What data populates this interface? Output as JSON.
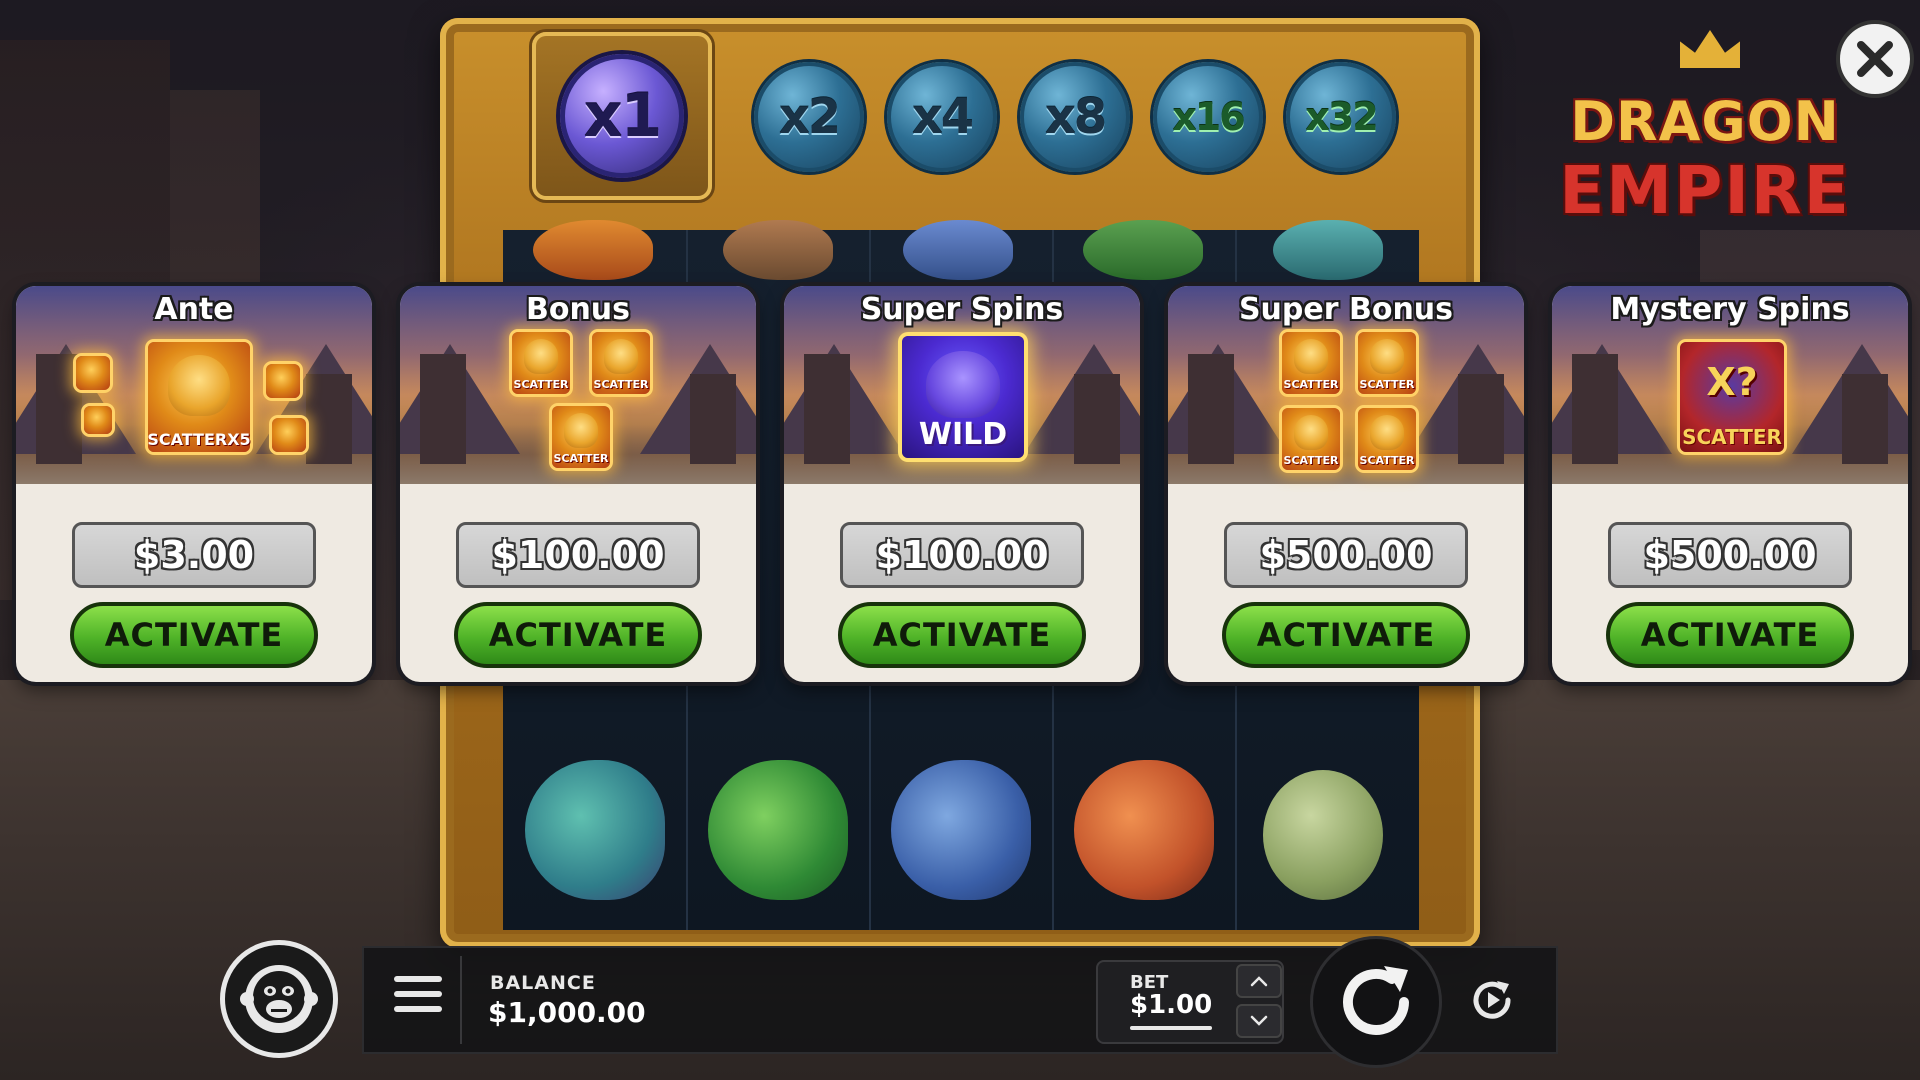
{
  "multipliers": [
    "x1",
    "x2",
    "x4",
    "x8",
    "x16",
    "x32"
  ],
  "active_multiplier": "x1",
  "logo": {
    "line1": "DRAGON",
    "line2": "EMPIRE"
  },
  "cards": [
    {
      "title": "Ante",
      "price": "$3.00",
      "button": "ACTIVATE",
      "symbol_label": "SCATTERX5"
    },
    {
      "title": "Bonus",
      "price": "$100.00",
      "button": "ACTIVATE",
      "symbol_label": "SCATTER"
    },
    {
      "title": "Super Spins",
      "price": "$100.00",
      "button": "ACTIVATE",
      "symbol_label": "WILD"
    },
    {
      "title": "Super Bonus",
      "price": "$500.00",
      "button": "ACTIVATE",
      "symbol_label": "SCATTER"
    },
    {
      "title": "Mystery Spins",
      "price": "$500.00",
      "button": "ACTIVATE",
      "symbol_label": "SCATTER",
      "symbol_mark": "X?"
    }
  ],
  "balance": {
    "label": "BALANCE",
    "value": "$1,000.00"
  },
  "bet": {
    "label": "BET",
    "value": "$1.00"
  },
  "icons": {
    "close": "close-icon",
    "menu": "hamburger-menu-icon",
    "avatar": "gorilla-icon",
    "spin": "refresh-arrow-icon",
    "autoplay": "autoplay-icon",
    "bet_up": "chevron-up-icon",
    "bet_down": "chevron-down-icon"
  },
  "colors": {
    "activate_green": "#4fb328",
    "frame_gold": "#c9902c",
    "logo_gold": "#f3c24a",
    "logo_red": "#d7342c"
  }
}
